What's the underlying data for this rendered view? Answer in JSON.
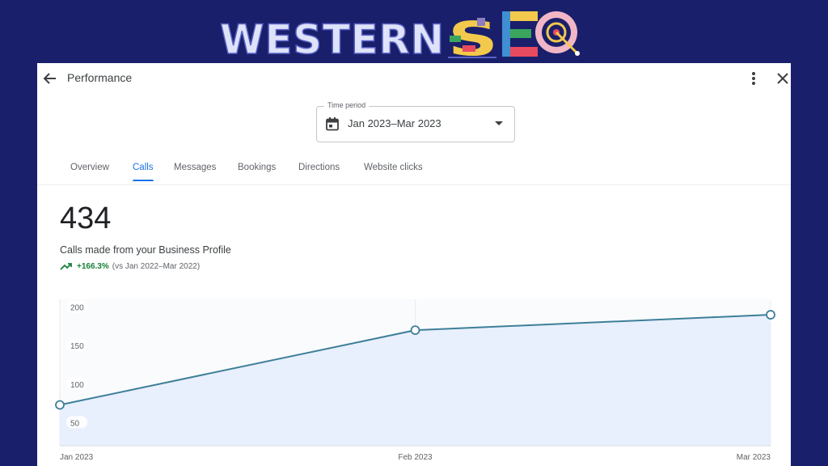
{
  "brand": {
    "part1": "WESTERN",
    "part2": "SEO"
  },
  "header": {
    "title": "Performance"
  },
  "time_period": {
    "label": "Time period",
    "value": "Jan 2023–Mar 2023"
  },
  "tabs": [
    {
      "label": "Overview",
      "active": false
    },
    {
      "label": "Calls",
      "active": true
    },
    {
      "label": "Messages",
      "active": false
    },
    {
      "label": "Bookings",
      "active": false
    },
    {
      "label": "Directions",
      "active": false
    },
    {
      "label": "Website clicks",
      "active": false
    }
  ],
  "metric": {
    "value": "434",
    "description": "Calls made from your Business Profile",
    "change": "+166.3%",
    "comparison": "(vs Jan 2022–Mar 2022)"
  },
  "colors": {
    "accent": "#1a73e8",
    "positive": "#188038",
    "line": "#3e7f98",
    "fill": "#e8effd",
    "background": "#1a1f6b"
  },
  "chart_data": {
    "type": "area",
    "categories": [
      "Jan 2023",
      "Feb 2023",
      "Mar 2023"
    ],
    "values": [
      73,
      170,
      190
    ],
    "yticks": [
      50,
      100,
      150,
      200
    ],
    "ylim": [
      20,
      210
    ],
    "grid": false,
    "title": "",
    "xlabel": "",
    "ylabel": ""
  }
}
